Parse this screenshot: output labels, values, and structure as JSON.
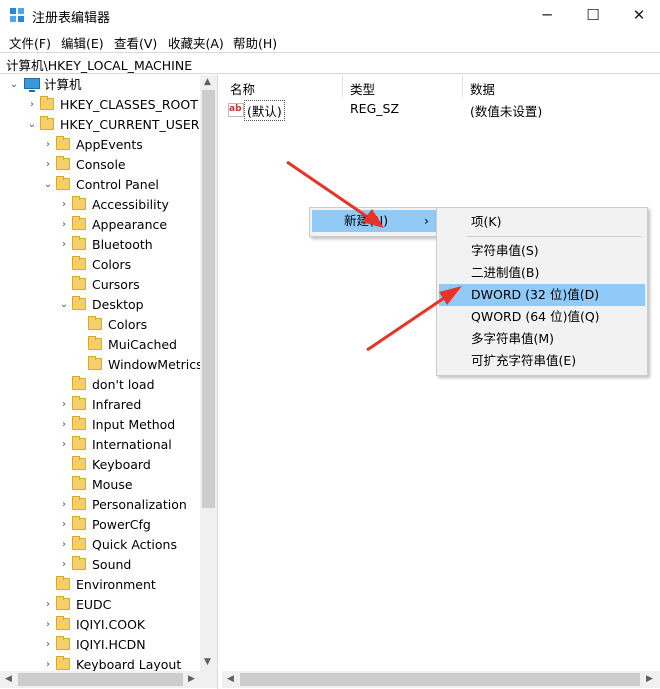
{
  "window": {
    "title": "注册表编辑器",
    "app_icon": "regedit-icon",
    "minimize": "─",
    "maximize": "☐",
    "close": "✕"
  },
  "menu": [
    "文件(F)",
    "编辑(E)",
    "查看(V)",
    "收藏夹(A)",
    "帮助(H)"
  ],
  "address": "计算机\\HKEY_LOCAL_MACHINE",
  "tree": {
    "root": "计算机",
    "nodes": [
      {
        "label": "HKEY_CLASSES_ROOT"
      },
      {
        "label": "HKEY_CURRENT_USER"
      },
      {
        "label": "AppEvents"
      },
      {
        "label": "Console"
      },
      {
        "label": "Control Panel"
      },
      {
        "label": "Accessibility"
      },
      {
        "label": "Appearance"
      },
      {
        "label": "Bluetooth"
      },
      {
        "label": "Colors"
      },
      {
        "label": "Cursors"
      },
      {
        "label": "Desktop"
      },
      {
        "label": "Colors"
      },
      {
        "label": "MuiCached"
      },
      {
        "label": "WindowMetrics"
      },
      {
        "label": "don't load"
      },
      {
        "label": "Infrared"
      },
      {
        "label": "Input Method"
      },
      {
        "label": "International"
      },
      {
        "label": "Keyboard"
      },
      {
        "label": "Mouse"
      },
      {
        "label": "Personalization"
      },
      {
        "label": "PowerCfg"
      },
      {
        "label": "Quick Actions"
      },
      {
        "label": "Sound"
      },
      {
        "label": "Environment"
      },
      {
        "label": "EUDC"
      },
      {
        "label": "IQIYI.COOK"
      },
      {
        "label": "IQIYI.HCDN"
      },
      {
        "label": "Keyboard Layout"
      }
    ]
  },
  "list": {
    "headers": {
      "name": "名称",
      "type": "类型",
      "data": "数据"
    },
    "rows": [
      {
        "icon": "ab",
        "name": "(默认)",
        "type": "REG_SZ",
        "data": "(数值未设置)"
      }
    ]
  },
  "context_menu": {
    "new_label": "新建(N)",
    "submenu_arrow": "›"
  },
  "submenu": [
    "项(K)",
    "字符串值(S)",
    "二进制值(B)",
    "DWORD (32 位)值(D)",
    "QWORD (64 位)值(Q)",
    "多字符串值(M)",
    "可扩充字符串值(E)"
  ],
  "colors": {
    "highlight": "#91c9f7",
    "arrow": "#e8332a",
    "folder": "#f5cf6b"
  }
}
